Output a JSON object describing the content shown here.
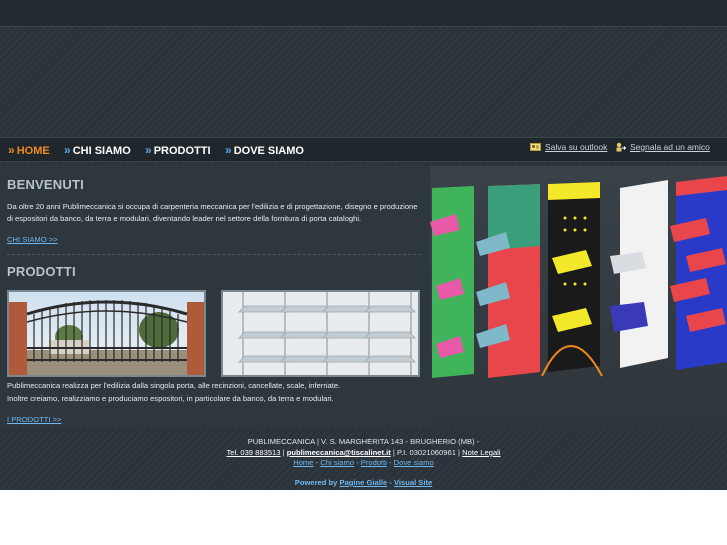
{
  "nav": {
    "items": [
      {
        "label": "HOME",
        "active": true
      },
      {
        "label": "CHI SIAMO",
        "active": false
      },
      {
        "label": "PRODOTTI",
        "active": false
      },
      {
        "label": "DOVE SIAMO",
        "active": false
      }
    ],
    "chevron": "»"
  },
  "utility": {
    "outlook_label": "Salva su outlook",
    "outlook_icon": "contact-card-icon",
    "friend_label": "Segnala ad un amico",
    "friend_icon": "user-share-icon"
  },
  "welcome": {
    "title": "BENVENUTI",
    "text": "Da oltre 20 anni Publimeccanica si occupa di carpenteria meccanica per l'edilizia e di progettazione, disegno e produzione di espositori da banco, da terra e modulari, diventando leader nel settore della fornitura di porta cataloghi.",
    "link": "CHI SIAMO >>"
  },
  "products": {
    "title": "PRODOTTI",
    "text_line1": "Publimeccanica realizza per l'edilizia dalla singola porta, alle recinzioni, cancellate, scale, inferriate.",
    "text_line2": "Inoltre creiamo, realizziamo e produciamo espositori, in particolare da banco, da terra e modulari.",
    "link": "I PRODOTTI >>"
  },
  "footer": {
    "line1": "PUBLIMECCANICA | V. S. MARGHERITA 143 - BRUGHERIO (MB) -",
    "tel": "Tel. 039 883513",
    "sep1": " | ",
    "email": "publimeccanica@tiscalinet.it",
    "piva": " | P.I. 03021060961 | ",
    "legal": "Note Legali",
    "links": [
      "Home",
      "Chi siamo",
      "Prodotti",
      "Dove siamo"
    ],
    "link_sep": " - ",
    "powered_prefix": "Powered by ",
    "powered_a": "Pagine Gialle",
    "powered_sep": " - ",
    "powered_b": "Visual Site"
  },
  "colors": {
    "accent_orange": "#f08a1c",
    "link_blue": "#6fb7ef",
    "background": "#2b333a"
  }
}
